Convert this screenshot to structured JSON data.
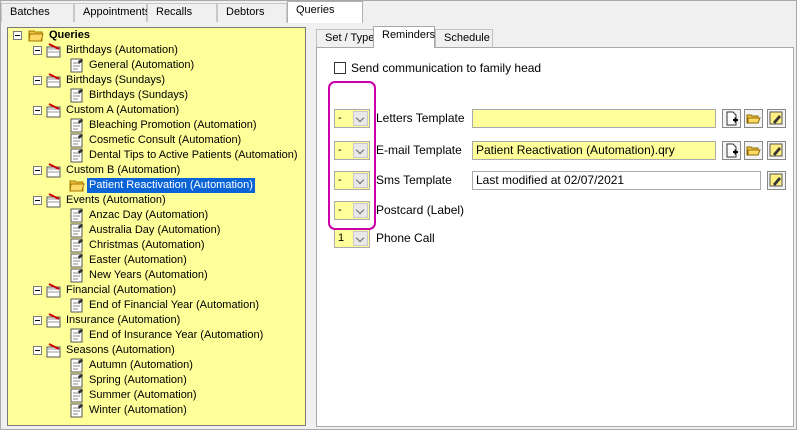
{
  "top_tabs": [
    {
      "label": "Batches"
    },
    {
      "label": "Appointments"
    },
    {
      "label": "Recalls"
    },
    {
      "label": "Debtors"
    },
    {
      "label": "Queries"
    }
  ],
  "tree": {
    "root": "Queries",
    "groups": [
      {
        "label": "Birthdays (Automation)",
        "children": [
          "General (Automation)"
        ]
      },
      {
        "label": "Birthdays (Sundays)",
        "children": [
          "Birthdays (Sundays)"
        ]
      },
      {
        "label": "Custom A (Automation)",
        "children": [
          "Bleaching Promotion (Automation)",
          "Cosmetic Consult (Automation)",
          "Dental Tips to Active Patients (Automation)"
        ]
      },
      {
        "label": "Custom B (Automation)",
        "children": [
          "Patient Reactivation (Automation)"
        ]
      },
      {
        "label": "Events (Automation)",
        "children": [
          "Anzac Day (Automation)",
          "Australia Day (Automation)",
          "Christmas (Automation)",
          "Easter (Automation)",
          "New Years (Automation)"
        ]
      },
      {
        "label": "Financial (Automation)",
        "children": [
          "End of Financial Year (Automation)"
        ]
      },
      {
        "label": "Insurance (Automation)",
        "children": [
          "End of Insurance Year (Automation)"
        ]
      },
      {
        "label": "Seasons (Automation)",
        "children": [
          "Autumn (Automation)",
          "Spring (Automation)",
          "Summer (Automation)",
          "Winter (Automation)"
        ]
      }
    ]
  },
  "sub_tabs": [
    {
      "label": "Set / Type"
    },
    {
      "label": "Reminders"
    },
    {
      "label": "Schedule"
    }
  ],
  "reminders": {
    "family_head_label": "Send communication to family head",
    "rows": [
      {
        "dropdown": "-",
        "label": "Letters Template",
        "value": ""
      },
      {
        "dropdown": "-",
        "label": "E-mail Template",
        "value": "Patient Reactivation (Automation).qry"
      },
      {
        "dropdown": "-",
        "label": "Sms Template",
        "value": "Last modified at 02/07/2021"
      },
      {
        "dropdown": "-",
        "label": "Postcard (Label)",
        "value": ""
      },
      {
        "dropdown": "1",
        "label": "Phone Call",
        "value": ""
      }
    ]
  },
  "colors": {
    "tree_bg": "#ffff99",
    "selection": "#0a64d8",
    "highlight": "#cc00aa"
  }
}
